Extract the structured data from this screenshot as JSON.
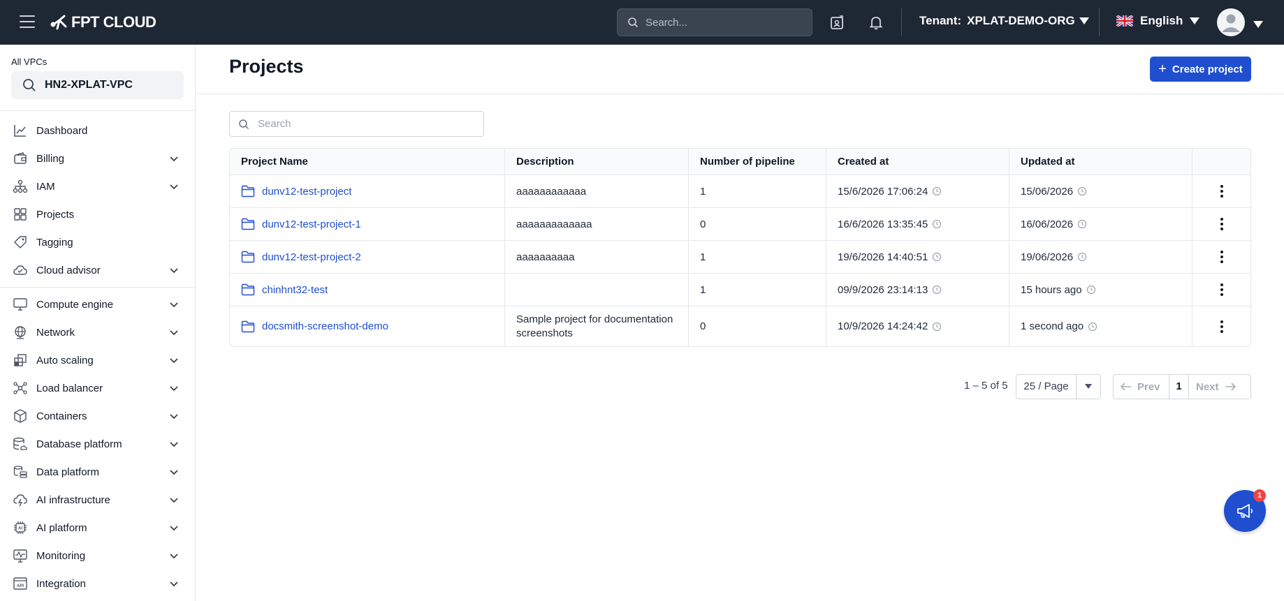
{
  "topbar": {
    "brand": "FPT CLOUD",
    "search_placeholder": "Search...",
    "tenant_label": "Tenant:",
    "tenant_value": "XPLAT-DEMO-ORG",
    "language": "English"
  },
  "sidebar": {
    "vpc_label": "All VPCs",
    "vpc_value": "HN2-XPLAT-VPC",
    "items": [
      {
        "label": "Dashboard",
        "icon": "chart-line-icon"
      },
      {
        "label": "Billing",
        "icon": "wallet-icon"
      },
      {
        "label": "IAM",
        "icon": "org-tree-icon"
      },
      {
        "label": "Projects",
        "icon": "grid-icon"
      },
      {
        "label": "Tagging",
        "icon": "tag-icon"
      },
      {
        "label": "Cloud advisor",
        "icon": "cloud-check-icon"
      },
      {
        "label": "Compute engine",
        "icon": "monitor-icon"
      },
      {
        "label": "Network",
        "icon": "globe-icon"
      },
      {
        "label": "Auto scaling",
        "icon": "scale-icon"
      },
      {
        "label": "Load balancer",
        "icon": "nodes-icon"
      },
      {
        "label": "Containers",
        "icon": "box-icon"
      },
      {
        "label": "Database platform",
        "icon": "database-icon"
      },
      {
        "label": "Data platform",
        "icon": "data-stack-icon"
      },
      {
        "label": "AI infrastructure",
        "icon": "cloud-bolt-icon"
      },
      {
        "label": "AI platform",
        "icon": "ai-chip-icon"
      },
      {
        "label": "Monitoring",
        "icon": "monitor-pulse-icon"
      },
      {
        "label": "Integration",
        "icon": "api-icon"
      }
    ]
  },
  "main": {
    "title": "Projects",
    "create_label": "Create project",
    "search_placeholder": "Search",
    "columns": [
      "Project Name",
      "Description",
      "Number of pipeline",
      "Created at",
      "Updated at"
    ],
    "rows": [
      {
        "name": "dunv12-test-project",
        "description": "aaaaaaaaaaaa",
        "pipelines": "1",
        "created": "15/6/2026 17:06:24",
        "updated": "15/06/2026"
      },
      {
        "name": "dunv12-test-project-1",
        "description": "aaaaaaaaaaaaa",
        "pipelines": "0",
        "created": "16/6/2026 13:35:45",
        "updated": "16/06/2026"
      },
      {
        "name": "dunv12-test-project-2",
        "description": "aaaaaaaaaa",
        "pipelines": "1",
        "created": "19/6/2026 14:40:51",
        "updated": "19/06/2026"
      },
      {
        "name": "chinhnt32-test",
        "description": "",
        "pipelines": "1",
        "created": "09/9/2026 23:14:13",
        "updated": "15 hours ago"
      },
      {
        "name": "docsmith-screenshot-demo",
        "description": "Sample project for documentation screenshots",
        "pipelines": "0",
        "created": "10/9/2026 14:24:42",
        "updated": "1 second ago"
      }
    ],
    "pagination": {
      "range": "1 – 5 of 5",
      "page_size": "25 / Page",
      "prev": "Prev",
      "page": "1",
      "next": "Next"
    }
  },
  "fab": {
    "badge": "1"
  }
}
